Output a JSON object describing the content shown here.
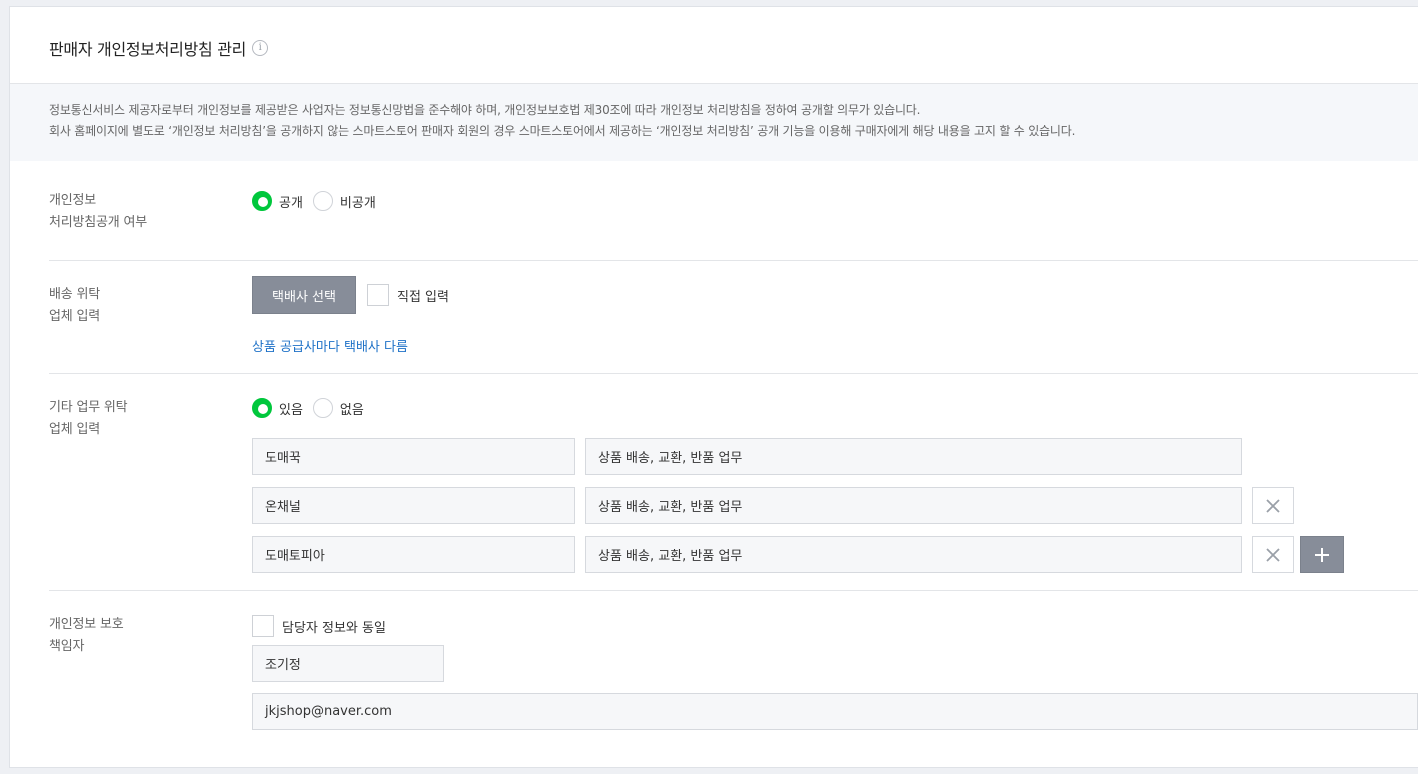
{
  "page": {
    "title": "판매자 개인정보처리방침 관리",
    "info_icon": "i"
  },
  "notice": {
    "line1": "정보통신서비스 제공자로부터 개인정보를 제공받은 사업자는 정보통신망법을 준수해야 하며, 개인정보보호법 제30조에 따라 개인정보 처리방침을 정하여 공개할 의무가 있습니다.",
    "line2": "회사 홈페이지에 별도로 ‘개인정보 처리방침’을 공개하지 않는 스마트스토어 판매자 회원의 경우 스마트스토어에서 제공하는 ‘개인정보 처리방침’ 공개 기능을 이용해 구매자에게 해당 내용을 고지 할 수 있습니다."
  },
  "disclosure": {
    "label_line1": "개인정보",
    "label_line2": "처리방침공개 여부",
    "options": [
      "공개",
      "비공개"
    ],
    "selected": "공개"
  },
  "delivery": {
    "label_line1": "배송 위탁",
    "label_line2": "업체 입력",
    "select_button": "택배사 선택",
    "manual_checkbox_label": "직접 입력",
    "manual_checked": false,
    "link_text": "상품 공급사마다 택배사 다름"
  },
  "other_outsourcing": {
    "label_line1": "기타 업무 위탁",
    "label_line2": "업체 입력",
    "options": [
      "있음",
      "없음"
    ],
    "selected": "있음",
    "rows": [
      {
        "company": "도매꾹",
        "task": "상품 배송, 교환, 반품 업무"
      },
      {
        "company": "온채널",
        "task": "상품 배송, 교환, 반품 업무"
      },
      {
        "company": "도매토피아",
        "task": "상품 배송, 교환, 반품 업무"
      }
    ],
    "remove_icon": "close-icon",
    "add_icon": "plus-icon"
  },
  "privacy_officer": {
    "label_line1": "개인정보 보호",
    "label_line2": "책임자",
    "same_as_manager_label": "담당자 정보와 동일",
    "same_as_manager_checked": false,
    "name": "조기정",
    "email": "jkjshop@naver.com"
  },
  "colors": {
    "accent_green": "#00c73c",
    "link_blue": "#1f72c7",
    "button_gray": "#878d99"
  }
}
